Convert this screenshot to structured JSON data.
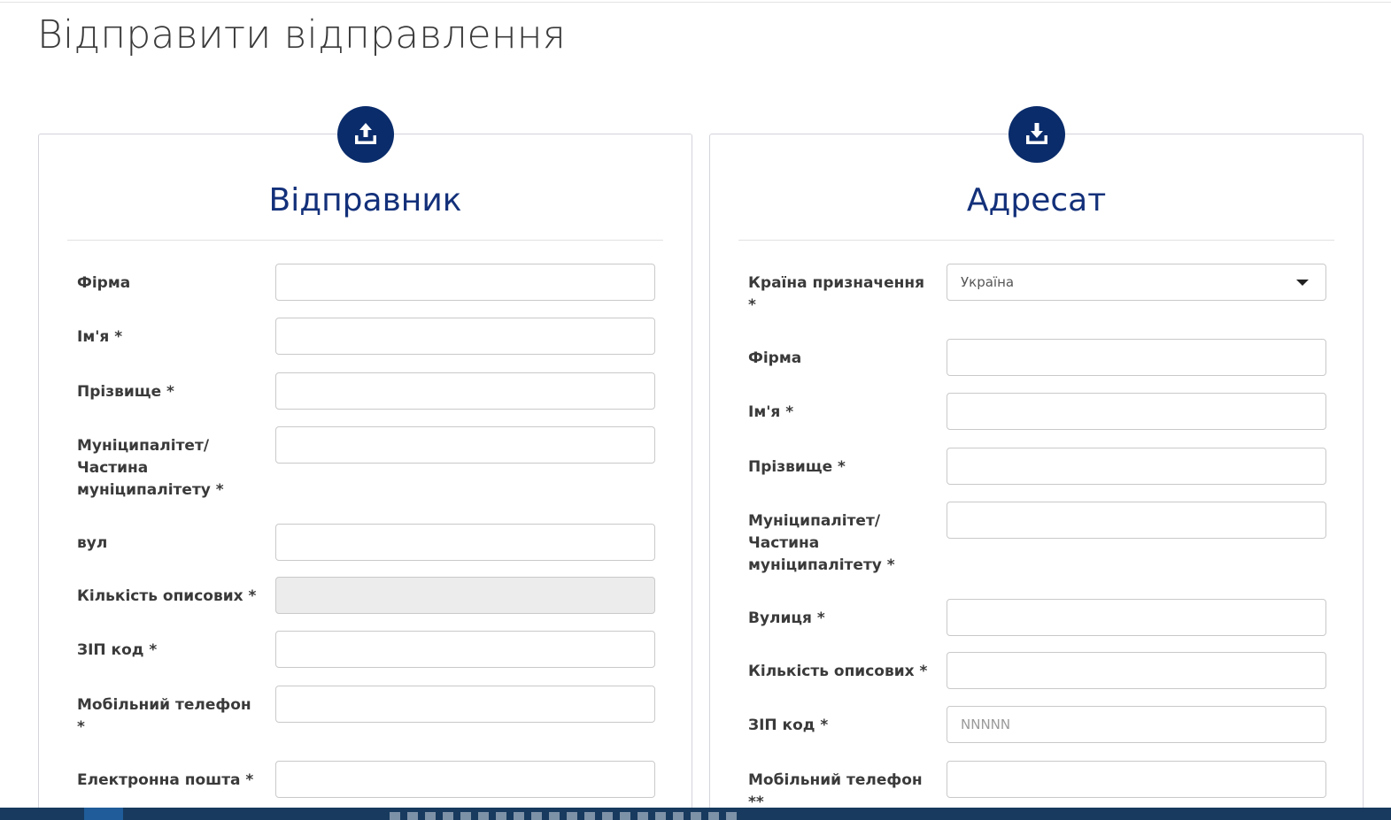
{
  "page": {
    "title": "Відправити відправлення"
  },
  "sender": {
    "title": "Відправник",
    "icon": "upload-icon",
    "fields": [
      {
        "label": "Фірма",
        "value": ""
      },
      {
        "label": "Ім'я *",
        "value": ""
      },
      {
        "label": "Прізвище *",
        "value": ""
      },
      {
        "label": "Муніципалітет/ Частина муніципалітету *",
        "value": ""
      },
      {
        "label": "вул",
        "value": ""
      },
      {
        "label": "Кількість описових *",
        "value": ""
      },
      {
        "label": "ЗІП код *",
        "value": ""
      },
      {
        "label": "Мобільний телефон *",
        "value": ""
      },
      {
        "label": "Електронна пошта *",
        "value": ""
      }
    ]
  },
  "recipient": {
    "title": "Адресат",
    "icon": "download-icon",
    "fields": [
      {
        "label": "Країна призначення *",
        "value": "Україна"
      },
      {
        "label": "Фірма",
        "value": ""
      },
      {
        "label": "Ім'я *",
        "value": ""
      },
      {
        "label": "Прізвище *",
        "value": ""
      },
      {
        "label": "Муніципалітет/ Частина муніципалітету *",
        "value": ""
      },
      {
        "label": "Вулиця *",
        "value": ""
      },
      {
        "label": "Кількість описових *",
        "value": ""
      },
      {
        "label": "ЗІП код *",
        "value": "",
        "placeholder": "NNNNN"
      },
      {
        "label": "Мобільний телефон **",
        "value": ""
      }
    ]
  },
  "colors": {
    "accent": "#0a2c6b",
    "heading": "#13307a",
    "taskbar": "#173a5e"
  }
}
